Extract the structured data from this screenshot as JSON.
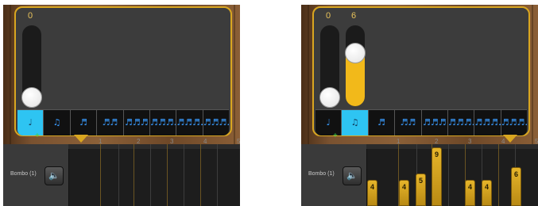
{
  "colors": {
    "accent": "#d9a620",
    "bar": "#e6b52a",
    "selected_segment": "#2ec4f2",
    "note_icon": "#3a9cff"
  },
  "left": {
    "sliders": [
      {
        "label": "0",
        "level": 0
      }
    ],
    "note_values": [
      {
        "icon": "quarter-note-icon",
        "glyph": "♩",
        "selected": true
      },
      {
        "icon": "eighth-notes-icon",
        "glyph": "♫",
        "selected": false
      },
      {
        "icon": "triplet-icon",
        "glyph": "♬",
        "selected": false
      },
      {
        "icon": "sixteenth-notes-icon",
        "glyph": "♬♬",
        "selected": false
      },
      {
        "icon": "sixteenth-triplet-icon",
        "glyph": "♬♬♬",
        "selected": false
      },
      {
        "icon": "thirty-second-notes-icon",
        "glyph": "♬♬♬♬",
        "selected": false
      },
      {
        "icon": "thirty-second-triplet-icon",
        "glyph": "♬♬♬♬",
        "selected": false
      },
      {
        "icon": "sixty-fourth-notes-icon",
        "glyph": "♬♬♬♬♬",
        "selected": false
      }
    ],
    "track": {
      "name": "Bombo (1)",
      "ruler": [
        "1",
        "2",
        "3",
        "4",
        "5"
      ]
    }
  },
  "right": {
    "sliders": [
      {
        "label": "0",
        "level": 0
      },
      {
        "label": "6",
        "level": 6
      }
    ],
    "note_values": [
      {
        "icon": "quarter-note-icon",
        "glyph": "♩",
        "selected": false
      },
      {
        "icon": "eighth-notes-icon",
        "glyph": "♫",
        "selected": true
      },
      {
        "icon": "triplet-icon",
        "glyph": "♬",
        "selected": false
      },
      {
        "icon": "sixteenth-notes-icon",
        "glyph": "♬♬",
        "selected": false
      },
      {
        "icon": "sixteenth-triplet-icon",
        "glyph": "♬♬♬",
        "selected": false
      },
      {
        "icon": "thirty-second-notes-icon",
        "glyph": "♬♬♬♬",
        "selected": false
      },
      {
        "icon": "thirty-second-triplet-icon",
        "glyph": "♬♬♬♬",
        "selected": false
      },
      {
        "icon": "sixty-fourth-notes-icon",
        "glyph": "♬♬♬♬♬",
        "selected": false
      }
    ],
    "track": {
      "name": "Bombo (1)",
      "ruler": [
        "1",
        "2",
        "3",
        "4",
        "5"
      ]
    },
    "bars": [
      {
        "label": "4",
        "value": 4
      },
      {
        "label": "4",
        "value": 4
      },
      {
        "label": "5",
        "value": 5
      },
      {
        "label": "9",
        "value": 9
      },
      {
        "label": "4",
        "value": 4
      },
      {
        "label": "4",
        "value": 4
      },
      {
        "label": "6",
        "value": 6
      }
    ]
  },
  "speaker_icon": "speaker-icon"
}
